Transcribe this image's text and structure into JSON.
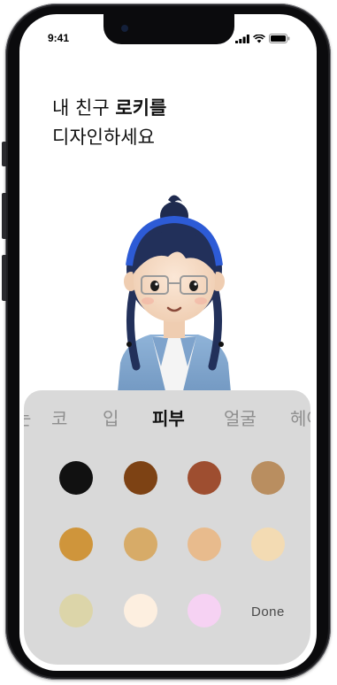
{
  "status_bar": {
    "time": "9:41"
  },
  "heading": {
    "line1_prefix": "내 친구 ",
    "line1_bold": "로키를",
    "line2": "디자인하세요"
  },
  "category_tabs": [
    {
      "label": "눈",
      "active": false
    },
    {
      "label": "코",
      "active": false
    },
    {
      "label": "입",
      "active": false
    },
    {
      "label": "피부",
      "active": true
    },
    {
      "label": "얼굴",
      "active": false
    },
    {
      "label": "헤어",
      "active": false
    }
  ],
  "skin_swatches": [
    {
      "color": "#111111"
    },
    {
      "color": "#7d4214"
    },
    {
      "color": "#9e4e30"
    },
    {
      "color": "#b98e60"
    },
    {
      "color": "#cf953b"
    },
    {
      "color": "#d7ab68"
    },
    {
      "color": "#e8bb8d"
    },
    {
      "color": "#f3dbb3"
    },
    {
      "color": "#dcd5a9"
    },
    {
      "color": "#fdefe0"
    },
    {
      "color": "#f6d2f3"
    }
  ],
  "done_label": "Done",
  "colors": {
    "sheet_background": "#d9d9d9",
    "active_tab": "#111111",
    "inactive_tab": "#8e8e8e"
  }
}
